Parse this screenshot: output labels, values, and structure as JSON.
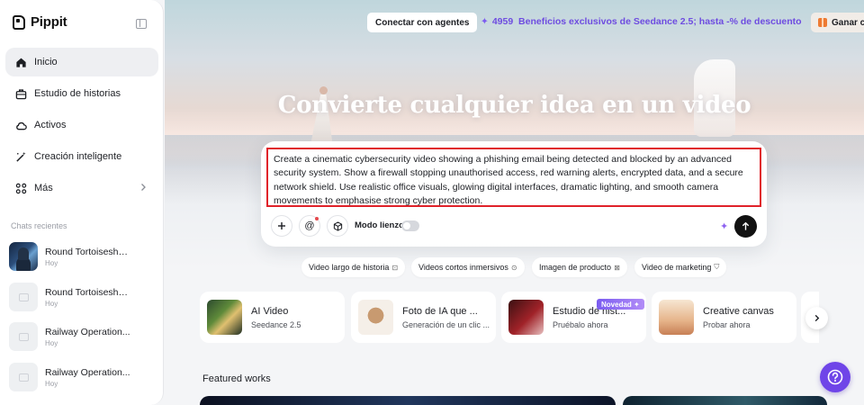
{
  "brand": {
    "name": "Pippit"
  },
  "nav": [
    {
      "label": "Inicio",
      "icon": "home-icon",
      "active": true
    },
    {
      "label": "Estudio de historias",
      "icon": "briefcase-icon"
    },
    {
      "label": "Activos",
      "icon": "cloud-icon"
    },
    {
      "label": "Creación inteligente",
      "icon": "magic-wand-icon"
    },
    {
      "label": "Más",
      "icon": "grid-icon"
    }
  ],
  "recent": {
    "title": "Chats recientes",
    "items": [
      {
        "name": "Round Tortoiseshel...",
        "date": "Hoy"
      },
      {
        "name": "Round Tortoiseshel...",
        "date": "Hoy"
      },
      {
        "name": "Railway Operation...",
        "date": "Hoy"
      },
      {
        "name": "Railway Operation...",
        "date": "Hoy"
      }
    ]
  },
  "topbar": {
    "connect_label": "Conectar con agentes",
    "promo_count": "4959",
    "promo_text": "Beneficios exclusivos de Seedance 2.5; hasta -% de descuento",
    "earn_label": "Ganar c"
  },
  "hero": {
    "title": "Convierte cualquier idea en un video"
  },
  "prompt": {
    "text": "Create a cinematic cybersecurity video showing a phishing email being detected and blocked by an advanced security system. Show a firewall stopping unauthorised access, red warning alerts, encrypted data, and a secure network shield. Use realistic office visuals, glowing digital interfaces, dramatic lighting, and smooth camera movements to emphasise strong cyber protection.",
    "canvas_mode_label": "Modo lienzo"
  },
  "chips": [
    {
      "label": "Video largo de historia"
    },
    {
      "label": "Videos cortos inmersivos"
    },
    {
      "label": "Imagen de producto"
    },
    {
      "label": "Video de marketing"
    }
  ],
  "cards": [
    {
      "title": "AI Video",
      "subtitle": "Seedance 2.5"
    },
    {
      "title": "Foto de IA que ...",
      "subtitle": "Generación de un clic ..."
    },
    {
      "title": "Estudio de hist...",
      "subtitle": "Pruébalo ahora",
      "badge": "Novedad ✦"
    },
    {
      "title": "Creative canvas",
      "subtitle": "Probar ahora"
    }
  ],
  "featured": {
    "title": "Featured works"
  },
  "colors": {
    "accent": "#6f45e8",
    "promo": "#6e4ce0",
    "highlight_border": "#e0222a"
  }
}
